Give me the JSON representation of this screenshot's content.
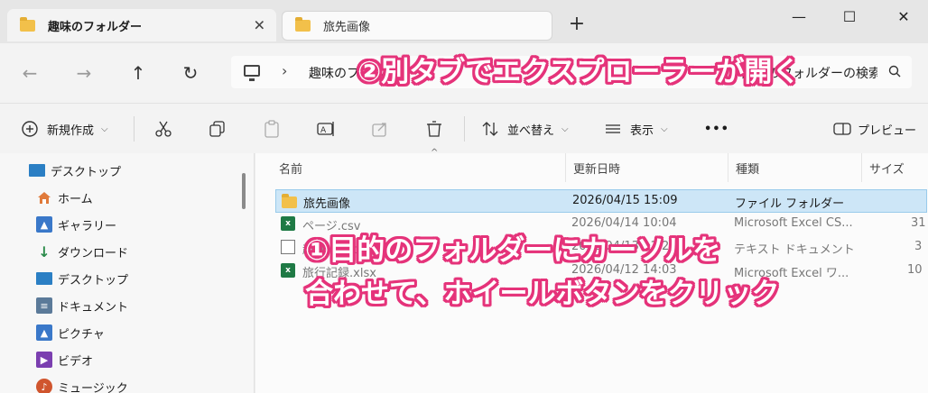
{
  "tabs": [
    {
      "label": "趣味のフォルダー",
      "close": "✕"
    },
    {
      "label": "旅先画像"
    }
  ],
  "new_tab": "+",
  "window": {
    "minimize": "—",
    "maximize": "☐",
    "close": "✕"
  },
  "nav": {
    "back": "←",
    "forward": "→",
    "up": "↑",
    "refresh": "↻"
  },
  "address": {
    "separator": "›",
    "path": "趣味のフォルダー"
  },
  "search": {
    "value": "趣味のフォルダーの検索"
  },
  "commands": {
    "new_label": "新規作成",
    "sort_label": "並べ替え",
    "view_label": "表示",
    "more": "•••",
    "preview_label": "プレビュー"
  },
  "sidebar": {
    "items": [
      {
        "label": "デスクトップ",
        "icon": "desktop-icon",
        "color": "#2b7fc4"
      },
      {
        "label": "ホーム",
        "icon": "home-icon",
        "color": "#e07a3a"
      },
      {
        "label": "ギャラリー",
        "icon": "gallery-icon",
        "color": "#3a78c9"
      },
      {
        "label": "ダウンロード",
        "icon": "download-icon",
        "color": "#2a8a4a"
      },
      {
        "label": "デスクトップ",
        "icon": "desktop-icon",
        "color": "#2b7fc4"
      },
      {
        "label": "ドキュメント",
        "icon": "document-icon",
        "color": "#5b7a99"
      },
      {
        "label": "ピクチャ",
        "icon": "pictures-icon",
        "color": "#3a78c9"
      },
      {
        "label": "ビデオ",
        "icon": "video-icon",
        "color": "#7b3fb0"
      },
      {
        "label": "ミュージック",
        "icon": "music-icon",
        "color": "#d0552e"
      }
    ]
  },
  "columns": {
    "name": "名前",
    "modified": "更新日時",
    "type": "種類",
    "size": "サイズ"
  },
  "files": [
    {
      "name": "旅先画像",
      "modified": "2026/04/15 15:09",
      "type": "ファイル フォルダー",
      "size": "",
      "kind": "folder"
    },
    {
      "name": "ページ.csv",
      "modified": "2026/04/14 10:04",
      "type": "Microsoft Excel CS...",
      "size": "31",
      "kind": "excel"
    },
    {
      "name": "趣味一覧.txt",
      "modified": "2026/04/13 11:20",
      "type": "テキスト ドキュメント",
      "size": "3",
      "kind": "text"
    },
    {
      "name": "旅行記録.xlsx",
      "modified": "2026/04/12 14:03",
      "type": "Microsoft Excel ワ...",
      "size": "10",
      "kind": "excel"
    }
  ],
  "annotations": {
    "top": "②別タブでエクスプローラーが開く",
    "bottom_line1": "①目的のフォルダーにカーソルを",
    "bottom_line2": "合わせて、ホイールボタンをクリック"
  },
  "colors": {
    "annotation_outline": "#e5337a",
    "selection": "#cde6f7"
  }
}
